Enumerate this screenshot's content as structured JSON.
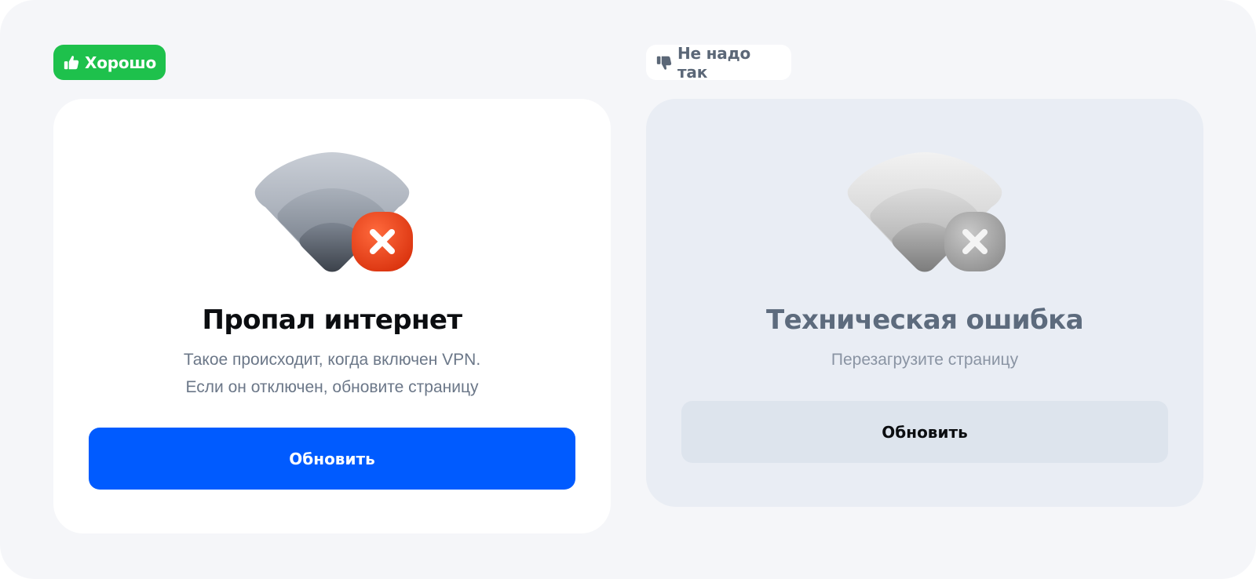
{
  "good": {
    "badge_label": "Хорошо",
    "badge_icon": "thumbs-up-icon",
    "accent_color": "#1ec14c",
    "title": "Пропал интернет",
    "description_lines": [
      "Такое происходит, когда включен VPN.",
      "Если он отключен, обновите страницу"
    ],
    "button_label": "Обновить",
    "button_color": "#005bff",
    "illustration": "wifi-error-icon"
  },
  "bad": {
    "badge_label": "Не надо так",
    "badge_icon": "thumbs-down-icon",
    "title": "Техническая ошибка",
    "description_lines": [
      "Перезагрузите страницу"
    ],
    "button_label": "Обновить",
    "illustration": "wifi-error-gray-icon"
  }
}
